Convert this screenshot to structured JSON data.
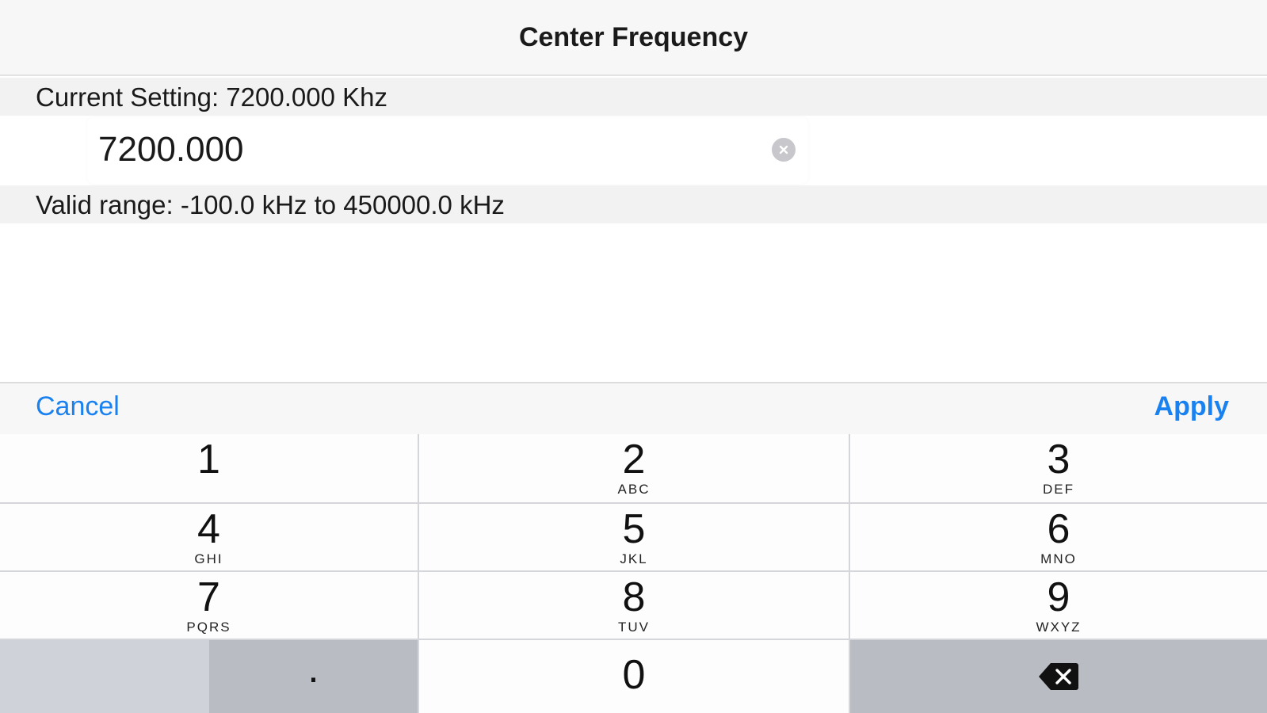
{
  "navbar": {
    "title": "Center Frequency"
  },
  "form": {
    "current_setting": "Current Setting: 7200.000 Khz",
    "frequency_value": "7200.000",
    "valid_range": "Valid range: -100.0 kHz to 450000.0 kHz"
  },
  "toolbar": {
    "cancel_label": "Cancel",
    "apply_label": "Apply"
  },
  "keypad": {
    "keys": [
      {
        "digit": "1",
        "letters": ""
      },
      {
        "digit": "2",
        "letters": "ABC"
      },
      {
        "digit": "3",
        "letters": "DEF"
      },
      {
        "digit": "4",
        "letters": "GHI"
      },
      {
        "digit": "5",
        "letters": "JKL"
      },
      {
        "digit": "6",
        "letters": "MNO"
      },
      {
        "digit": "7",
        "letters": "PQRS"
      },
      {
        "digit": "8",
        "letters": "TUV"
      },
      {
        "digit": "9",
        "letters": "WXYZ"
      }
    ],
    "dot": ".",
    "zero": "0",
    "delete_icon": "backspace-icon"
  },
  "colors": {
    "accent": "#1a82f0",
    "key_background": "#fdfdfd",
    "key_gray": "#b9bcc3"
  }
}
